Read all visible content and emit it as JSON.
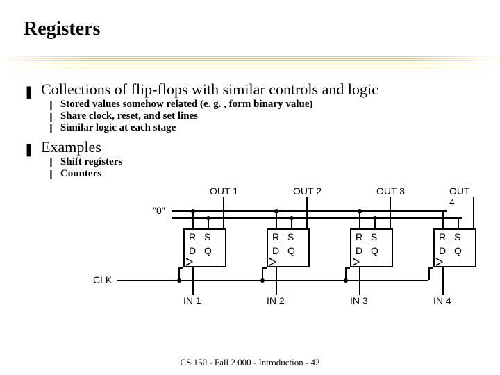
{
  "title": "Registers",
  "bullets": [
    {
      "text": "Collections of flip-flops with similar controls and logic",
      "sub": [
        "Stored values somehow related (e. g. , form binary value)",
        "Share clock, reset, and set lines",
        "Similar logic at each stage"
      ]
    },
    {
      "text": "Examples",
      "sub": [
        "Shift registers",
        "Counters"
      ]
    }
  ],
  "diagram": {
    "zero_label": "\"0\"",
    "clk_label": "CLK",
    "ff_labels": {
      "r": "R",
      "s": "S",
      "d": "D",
      "q": "Q"
    },
    "outputs": [
      "OUT 1",
      "OUT 2",
      "OUT 3",
      "OUT 4"
    ],
    "inputs": [
      "IN 1",
      "IN 2",
      "IN 3",
      "IN 4"
    ]
  },
  "footer": "CS 150 - Fall 2 000 - Introduction - 42"
}
